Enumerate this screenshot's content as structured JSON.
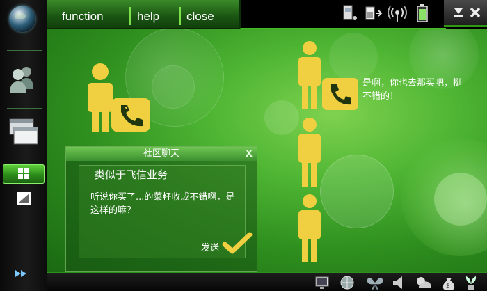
{
  "menu": {
    "function_label": "function",
    "help_label": "help",
    "close_label": "close"
  },
  "chat": {
    "title": "社区聊天",
    "close_label": "X",
    "heading": "类似于飞信业务",
    "message": "听说你买了...的菜籽收成不错啊，是这样的嘛？",
    "send_label": "发送"
  },
  "reply_bubble": {
    "text": "是啊，你也去那买吧，挺不错的！"
  },
  "colors": {
    "accent_green": "#4fb634",
    "person_yellow": "#f0d040",
    "phone_bg": "#f0d040"
  },
  "icons": {
    "sidebar": [
      "globe-icon",
      "contacts-icon",
      "windows-icon",
      "grid-icon",
      "resize-icon",
      "fast-forward-icon"
    ],
    "tray": [
      "device-icon",
      "battery-in-icon",
      "signal-icon",
      "battery-icon"
    ],
    "window": [
      "minimize-icon",
      "close-icon"
    ],
    "taskbar": [
      "monitor-icon",
      "settings-globe-icon",
      "butterfly-icon",
      "speaker-icon",
      "weather-icon",
      "money-bag-icon",
      "plant-icon"
    ]
  }
}
